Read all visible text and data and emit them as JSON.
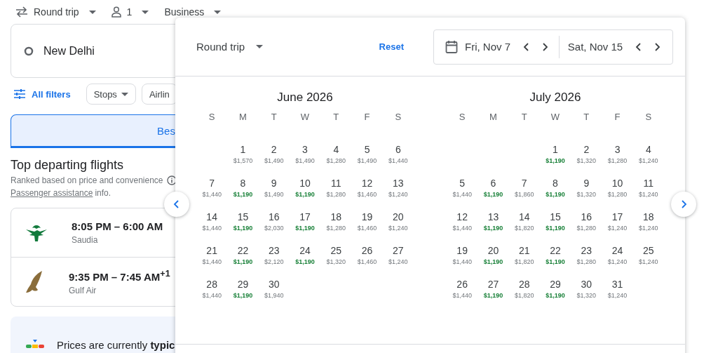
{
  "top_bar": {
    "trip_type": "Round trip",
    "passengers": "1",
    "cabin": "Business"
  },
  "search": {
    "origin": "New Delhi"
  },
  "filters": {
    "all_filters": "All filters",
    "chips": [
      "Stops",
      "Airlin"
    ]
  },
  "tabs": [
    {
      "label": "Bes",
      "selected": true
    }
  ],
  "section": {
    "title": "Top departing flights",
    "subtitle": "Ranked based on price and convenience",
    "link": "Passenger assistance",
    "link_suffix": "info."
  },
  "flights": [
    {
      "times": "8:05 PM – 6:00 AM",
      "airline": "Saudia",
      "kind": "palm"
    },
    {
      "times": "9:35 PM – 7:45 AM$^{+1}$",
      "airline": "Gulf Air",
      "kind": "falcon"
    }
  ],
  "price_insight": "Prices are currently **typic**",
  "date_picker": {
    "trip_type": "Round trip",
    "reset": "Reset",
    "departure": "Fri, Nov 7",
    "return": "Sat, Nov 15",
    "months": [
      {
        "title": "June 2026",
        "weekdays": [
          "S",
          "M",
          "T",
          "W",
          "T",
          "F",
          "S"
        ],
        "weeks": [
          {
            "kind": "partial",
            "days": [
              {
                "day": "1",
                "price": "$1,570",
                "cheap": false
              },
              {
                "day": "2",
                "price": "$1,490",
                "cheap": false
              },
              {
                "day": "3",
                "price": "$1,490",
                "cheap": false
              },
              {
                "day": "4",
                "price": "$1,280",
                "cheap": false
              },
              {
                "day": "5",
                "price": "$1,490",
                "cheap": false
              },
              {
                "day": "6",
                "price": "$1,440",
                "cheap": false
              }
            ]
          },
          {
            "kind": "full",
            "days": [
              {
                "day": "7",
                "price": "$1,440",
                "cheap": false
              },
              {
                "day": "8",
                "price": "$1,190",
                "cheap": true
              },
              {
                "day": "9",
                "price": "$1,490",
                "cheap": false
              },
              {
                "day": "10",
                "price": "$1,190",
                "cheap": true
              },
              {
                "day": "11",
                "price": "$1,280",
                "cheap": false
              },
              {
                "day": "12",
                "price": "$1,460",
                "cheap": false
              },
              {
                "day": "13",
                "price": "$1,240",
                "cheap": false
              }
            ]
          },
          {
            "kind": "full",
            "days": [
              {
                "day": "14",
                "price": "$1,440",
                "cheap": false
              },
              {
                "day": "15",
                "price": "$1,190",
                "cheap": true
              },
              {
                "day": "16",
                "price": "$2,030",
                "cheap": false
              },
              {
                "day": "17",
                "price": "$1,190",
                "cheap": true
              },
              {
                "day": "18",
                "price": "$1,280",
                "cheap": false
              },
              {
                "day": "19",
                "price": "$1,460",
                "cheap": false
              },
              {
                "day": "20",
                "price": "$1,240",
                "cheap": false
              }
            ]
          },
          {
            "kind": "full",
            "days": [
              {
                "day": "21",
                "price": "$1,440",
                "cheap": false
              },
              {
                "day": "22",
                "price": "$1,190",
                "cheap": true
              },
              {
                "day": "23",
                "price": "$2,120",
                "cheap": false
              },
              {
                "day": "24",
                "price": "$1,190",
                "cheap": true
              },
              {
                "day": "25",
                "price": "$1,320",
                "cheap": false
              },
              {
                "day": "26",
                "price": "$1,460",
                "cheap": false
              },
              {
                "day": "27",
                "price": "$1,240",
                "cheap": false
              }
            ]
          },
          {
            "kind": "full",
            "days": [
              {
                "day": "28",
                "price": "$1,440",
                "cheap": false
              },
              {
                "day": "29",
                "price": "$1,190",
                "cheap": true
              },
              {
                "day": "30",
                "price": "$1,940",
                "cheap": false
              }
            ]
          }
        ]
      },
      {
        "title": "July 2026",
        "weekdays": [
          "S",
          "M",
          "T",
          "W",
          "T",
          "F",
          "S"
        ],
        "weeks": [
          {
            "kind": "partial",
            "days": [
              {
                "day": "1",
                "price": "$1,190",
                "cheap": true
              },
              {
                "day": "2",
                "price": "$1,320",
                "cheap": false
              },
              {
                "day": "3",
                "price": "$1,280",
                "cheap": false
              },
              {
                "day": "4",
                "price": "$1,240",
                "cheap": false
              }
            ]
          },
          {
            "kind": "full",
            "days": [
              {
                "day": "5",
                "price": "$1,440",
                "cheap": false
              },
              {
                "day": "6",
                "price": "$1,190",
                "cheap": true
              },
              {
                "day": "7",
                "price": "$1,860",
                "cheap": false
              },
              {
                "day": "8",
                "price": "$1,190",
                "cheap": true
              },
              {
                "day": "9",
                "price": "$1,320",
                "cheap": false
              },
              {
                "day": "10",
                "price": "$1,280",
                "cheap": false
              },
              {
                "day": "11",
                "price": "$1,240",
                "cheap": false
              }
            ]
          },
          {
            "kind": "full",
            "days": [
              {
                "day": "12",
                "price": "$1,440",
                "cheap": false
              },
              {
                "day": "13",
                "price": "$1,190",
                "cheap": true
              },
              {
                "day": "14",
                "price": "$1,820",
                "cheap": false
              },
              {
                "day": "15",
                "price": "$1,190",
                "cheap": true
              },
              {
                "day": "16",
                "price": "$1,280",
                "cheap": false
              },
              {
                "day": "17",
                "price": "$1,240",
                "cheap": false
              },
              {
                "day": "18",
                "price": "$1,240",
                "cheap": false
              }
            ]
          },
          {
            "kind": "full",
            "days": [
              {
                "day": "19",
                "price": "$1,440",
                "cheap": false
              },
              {
                "day": "20",
                "price": "$1,190",
                "cheap": true
              },
              {
                "day": "21",
                "price": "$1,820",
                "cheap": false
              },
              {
                "day": "22",
                "price": "$1,190",
                "cheap": true
              },
              {
                "day": "23",
                "price": "$1,280",
                "cheap": false
              },
              {
                "day": "24",
                "price": "$1,240",
                "cheap": false
              },
              {
                "day": "25",
                "price": "$1,240",
                "cheap": false
              }
            ]
          },
          {
            "kind": "full",
            "days": [
              {
                "day": "26",
                "price": "$1,440",
                "cheap": false
              },
              {
                "day": "27",
                "price": "$1,190",
                "cheap": true
              },
              {
                "day": "28",
                "price": "$1,820",
                "cheap": false
              },
              {
                "day": "29",
                "price": "$1,190",
                "cheap": true
              },
              {
                "day": "30",
                "price": "$1,320",
                "cheap": false
              },
              {
                "day": "31",
                "price": "$1,240",
                "cheap": false
              }
            ]
          }
        ]
      }
    ]
  }
}
